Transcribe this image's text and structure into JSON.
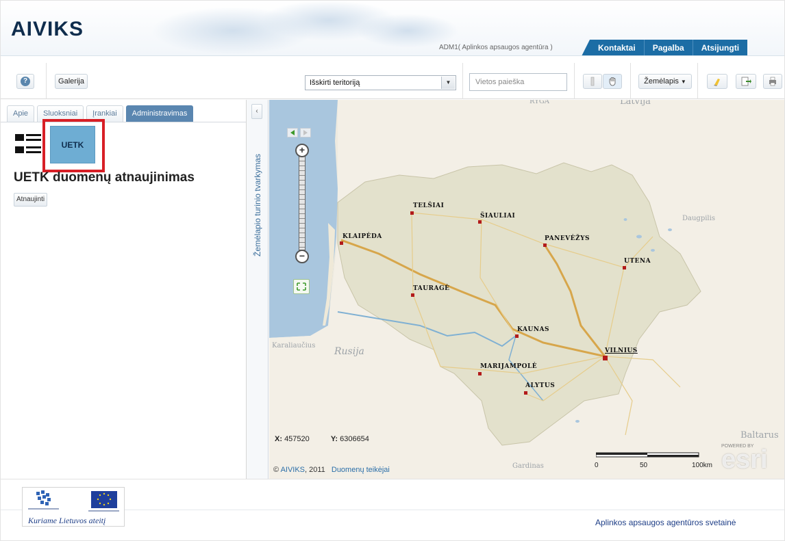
{
  "header": {
    "logo": "AIVIKS",
    "user": "ADM1( Aplinkos apsaugos agentūra )",
    "nav": [
      "Kontaktai",
      "Pagalba",
      "Atsijungti"
    ]
  },
  "toolbar": {
    "help_icon": "help-icon",
    "gallery_label": "Galerija",
    "select_value": "Išskirti teritoriją",
    "search_placeholder": "Vietos paieška",
    "basemap_label": "Žemėlapis",
    "icons": [
      "identify-icon",
      "pan-hand-icon",
      "eraser-icon",
      "export-icon",
      "print-icon"
    ]
  },
  "left_panel": {
    "tabs": [
      "Apie",
      "Sluoksniai",
      "Įrankiai",
      "Administravimas"
    ],
    "active_tab": "Administravimas",
    "tile_label": "UETK",
    "heading": "UETK duomenų atnaujinimas",
    "refresh_label": "Atnaujinti"
  },
  "side_strip": {
    "collapse_glyph": "‹",
    "vertical_label": "Žemėlapio turinio tvarkymas"
  },
  "map": {
    "cities": [
      "TELŠIAI",
      "ŠIAULIAI",
      "KLAIPĖDA",
      "PANEVĖŽYS",
      "UTENA",
      "TAURAGĖ",
      "KAUNAS",
      "VILNIUS",
      "MARIJAMPOLĖ",
      "ALYTUS"
    ],
    "context_labels": [
      "RYGA",
      "Latvija",
      "Daugpilis",
      "Karaliaučius",
      "Rusija",
      "Baltarus",
      "Gardinas"
    ],
    "coords": {
      "x_label": "X:",
      "x": "457520",
      "y_label": "Y:",
      "y": "6306654"
    },
    "copyright": {
      "symbol": "©",
      "link": "AIVIKS",
      "year": ", 2011",
      "providers": "Duomenų teikėjai"
    },
    "scale": {
      "zero": "0",
      "mid": "50",
      "end": "100km"
    },
    "esri": "esri",
    "powered": "POWERED BY"
  },
  "footer": {
    "motto": "Kuriame Lietuvos ateitį",
    "agency_link": "Aplinkos apsaugos agentūros svetainė"
  },
  "colors": {
    "brand_blue": "#1c6da5",
    "active_tab": "#5a86b0",
    "tile": "#6eadd3",
    "highlight": "#d81f26",
    "city": "#b21b1b"
  }
}
